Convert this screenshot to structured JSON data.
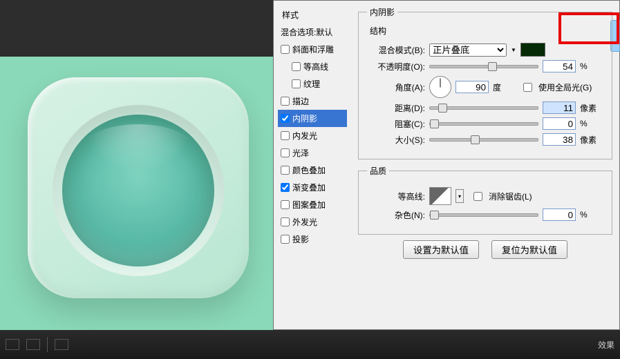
{
  "styles": {
    "header": "样式",
    "blending": "混合选项:默认",
    "items": [
      {
        "label": "斜面和浮雕",
        "checked": false
      },
      {
        "label": "等高线",
        "checked": false,
        "indent": true
      },
      {
        "label": "纹理",
        "checked": false,
        "indent": true
      },
      {
        "label": "描边",
        "checked": false
      },
      {
        "label": "内阴影",
        "checked": true,
        "selected": true
      },
      {
        "label": "内发光",
        "checked": false
      },
      {
        "label": "光泽",
        "checked": false
      },
      {
        "label": "颜色叠加",
        "checked": false
      },
      {
        "label": "渐变叠加",
        "checked": true
      },
      {
        "label": "图案叠加",
        "checked": false
      },
      {
        "label": "外发光",
        "checked": false
      },
      {
        "label": "投影",
        "checked": false
      }
    ]
  },
  "panel": {
    "title": "内阴影",
    "structure": {
      "legend": "结构",
      "blend_label": "混合模式(B):",
      "blend_value": "正片叠底",
      "opacity_label": "不透明度(O):",
      "opacity_value": "54",
      "opacity_unit": "%",
      "angle_label": "角度(A):",
      "angle_value": "90",
      "angle_unit": "度",
      "global_label": "使用全局光(G)",
      "distance_label": "距离(D):",
      "distance_value": "11",
      "distance_unit": "像素",
      "choke_label": "阻塞(C):",
      "choke_value": "0",
      "choke_unit": "%",
      "size_label": "大小(S):",
      "size_value": "38",
      "size_unit": "像素"
    },
    "quality": {
      "legend": "品质",
      "contour_label": "等高线:",
      "aa_label": "消除锯齿(L)",
      "noise_label": "杂色(N):",
      "noise_value": "0",
      "noise_unit": "%"
    },
    "btn_default": "设置为默认值",
    "btn_reset": "复位为默认值"
  },
  "bottom": {
    "fx": "效果"
  }
}
